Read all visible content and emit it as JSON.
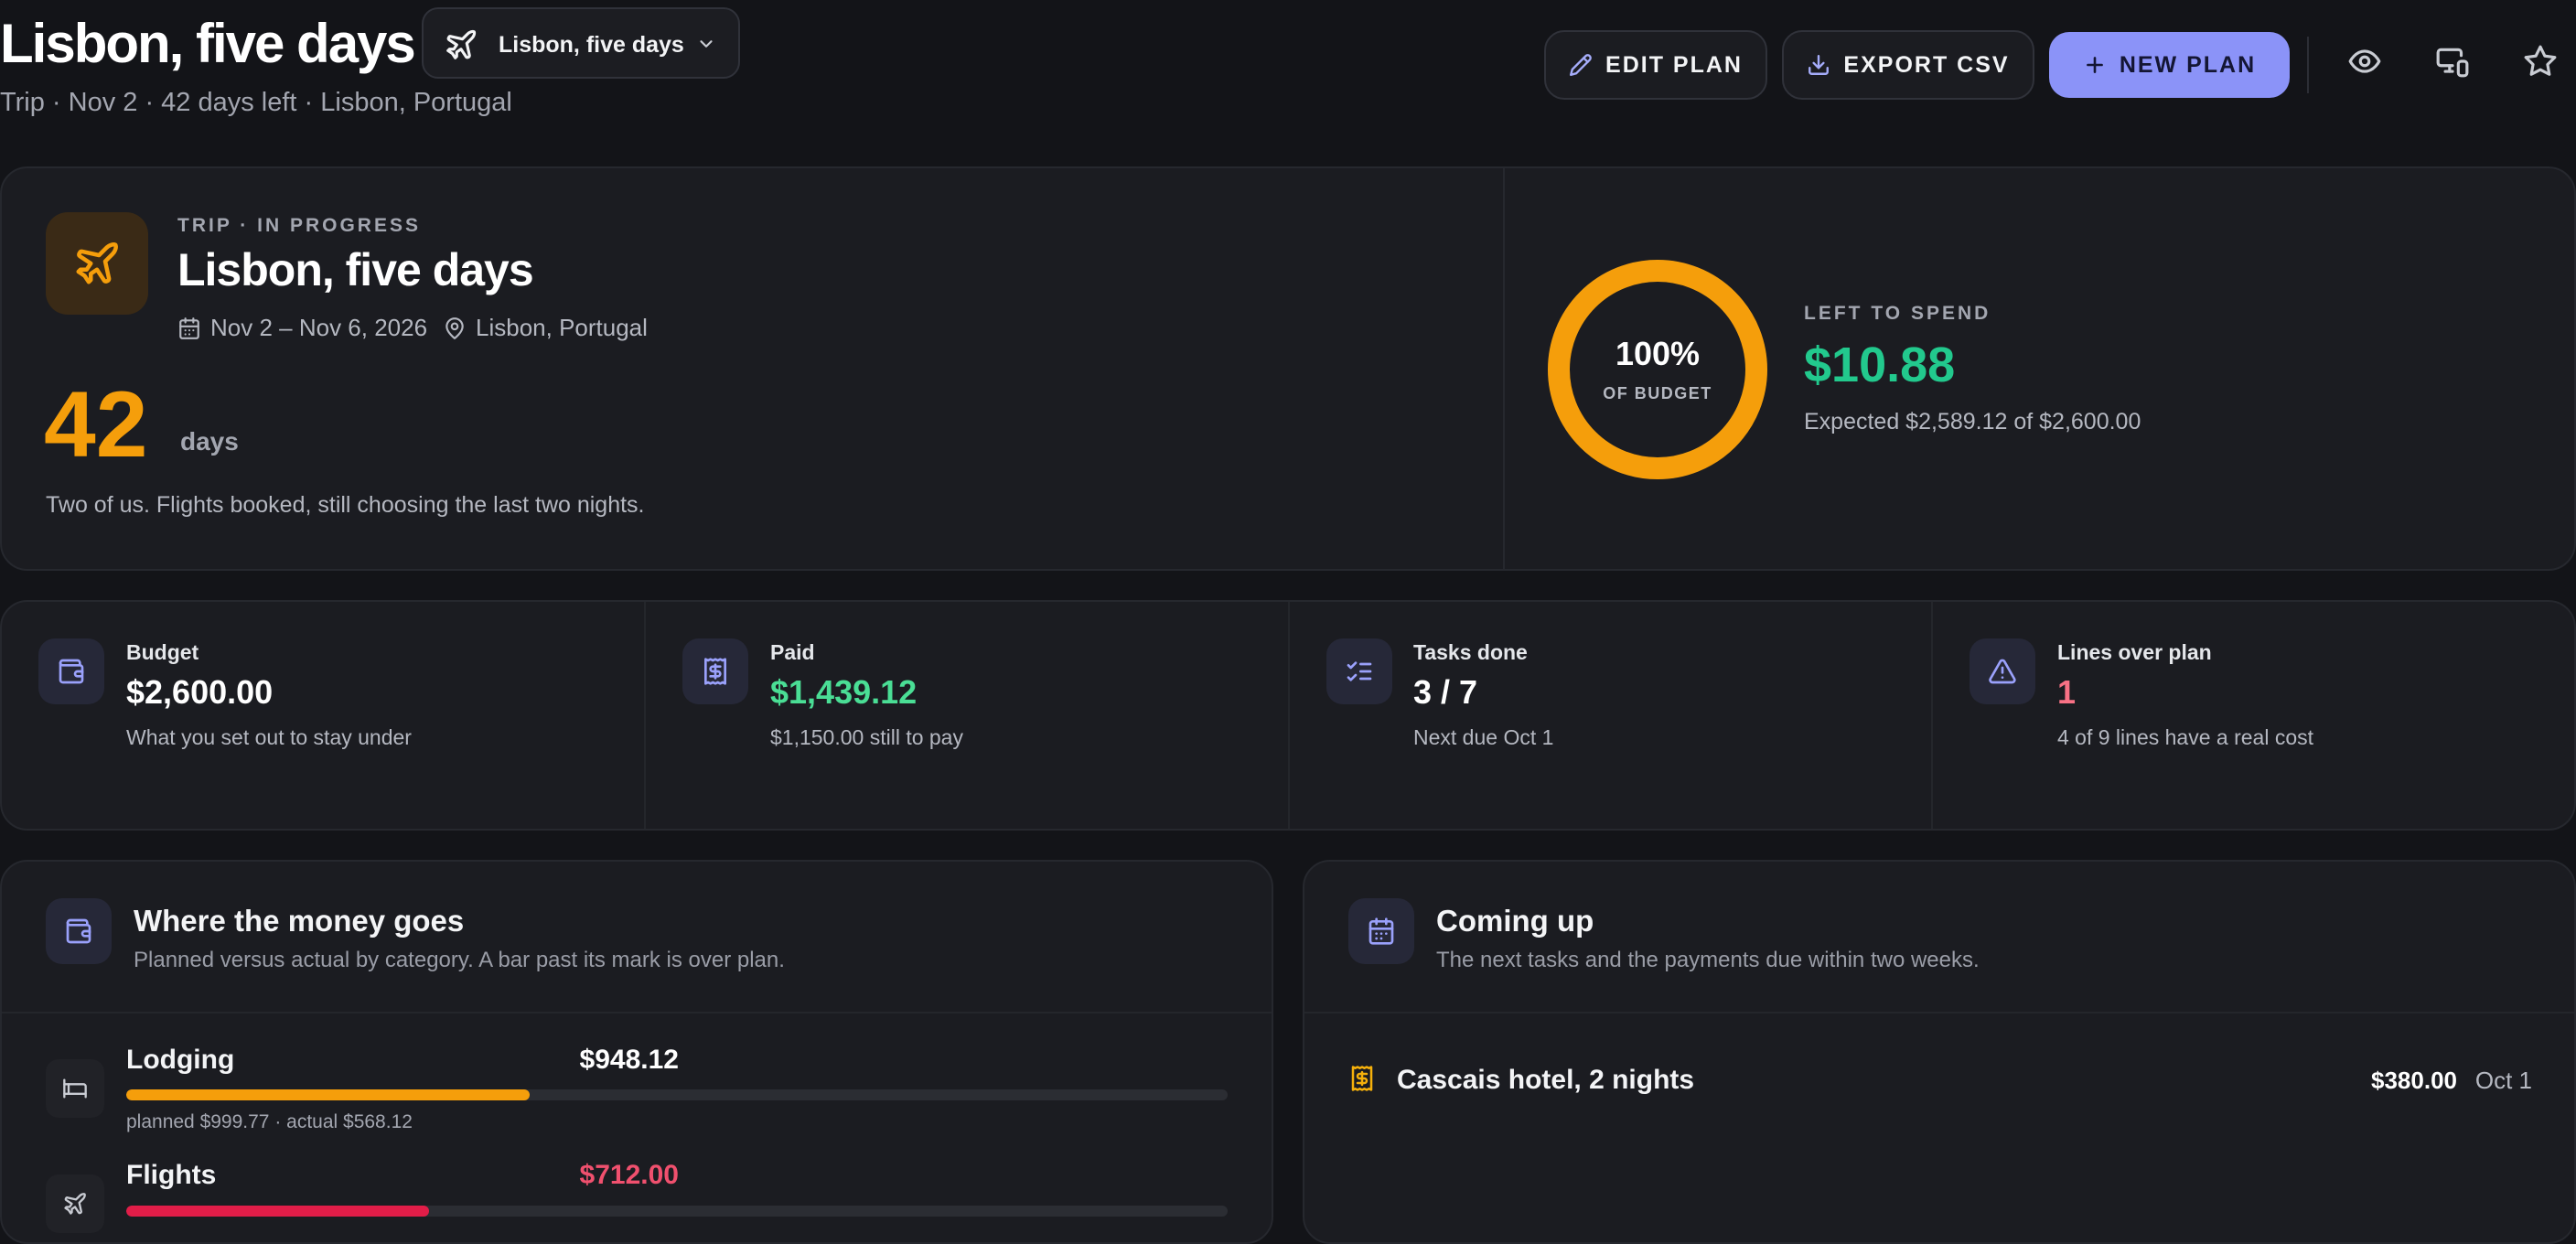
{
  "header": {
    "title": "Lisbon, five days",
    "plan_selector": {
      "label": "Lisbon, five days",
      "icon": "plane-icon"
    },
    "subtitle": "Trip · Nov 2 · 42 days left · Lisbon, Portugal",
    "actions": {
      "edit": "EDIT PLAN",
      "export": "EXPORT CSV",
      "new": "NEW PLAN"
    },
    "icons": [
      "eye-icon",
      "devices-icon",
      "star-icon"
    ]
  },
  "hero": {
    "eyebrow": "TRIP · IN PROGRESS",
    "title": "Lisbon, five days",
    "dates": "Nov 2 – Nov 6, 2026",
    "location": "Lisbon, Portugal",
    "countdown_value": "42",
    "countdown_unit": "days",
    "note": "Two of us. Flights booked, still choosing the last two nights.",
    "budget_ring": {
      "percent_label": "100%",
      "sub_label": "OF BUDGET",
      "fraction": 1.0
    },
    "left_label": "LEFT TO SPEND",
    "left_amount": "$10.88",
    "expected": "Expected $2,589.12 of $2,600.00"
  },
  "stats": [
    {
      "label": "Budget",
      "value": "$2,600.00",
      "caption": "What you set out to stay under",
      "icon": "wallet-icon",
      "color": "#ffffff"
    },
    {
      "label": "Paid",
      "value": "$1,439.12",
      "caption": "$1,150.00 still to pay",
      "icon": "receipt-icon",
      "color": "#4ade95"
    },
    {
      "label": "Tasks done",
      "value": "3 / 7",
      "caption": "Next due Oct 1",
      "icon": "checklist-icon",
      "color": "#ffffff"
    },
    {
      "label": "Lines over plan",
      "value": "1",
      "caption": "4 of 9 lines have a real cost",
      "icon": "warning-icon",
      "color": "#f87185"
    }
  ],
  "money": {
    "title": "Where the money goes",
    "description": "Planned versus actual by category. A bar past its mark is over plan.",
    "categories": [
      {
        "name": "Lodging",
        "amount": "$948.12",
        "amount_color": "#ffffff",
        "bar_color": "#f59e0b",
        "fraction": 0.366,
        "sub": "planned $999.77 · actual $568.12",
        "icon": "bed-icon"
      },
      {
        "name": "Flights",
        "amount": "$712.00",
        "amount_color": "#f0506e",
        "bar_color": "#e11d48",
        "fraction": 0.275,
        "sub": "",
        "icon": "plane-icon"
      }
    ]
  },
  "upcoming": {
    "title": "Coming up",
    "description": "The next tasks and the payments due within two weeks.",
    "items": [
      {
        "title": "Cascais hotel, 2 nights",
        "amount": "$380.00",
        "date": "Oct 1",
        "icon": "receipt-icon"
      }
    ]
  },
  "colors": {
    "accent": "#8b93f8",
    "warning": "#f59e0b",
    "positive": "#22c98d",
    "negative": "#f0506e"
  }
}
